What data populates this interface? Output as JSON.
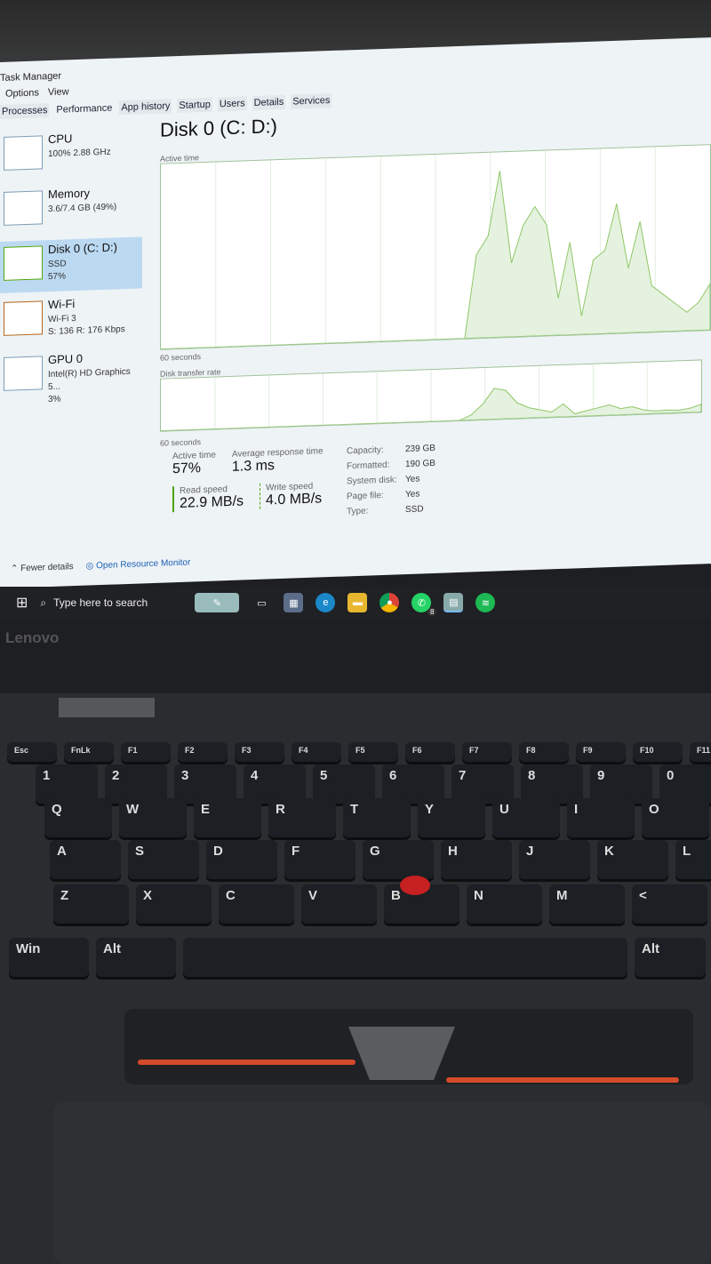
{
  "window": {
    "title": "Task Manager",
    "menu": [
      "Options",
      "View"
    ],
    "tabs": [
      "Processes",
      "Performance",
      "App history",
      "Startup",
      "Users",
      "Details",
      "Services"
    ],
    "active_tab": "Performance"
  },
  "sidebar": [
    {
      "name": "CPU",
      "line1": "100% 2.88 GHz",
      "line2": ""
    },
    {
      "name": "Memory",
      "line1": "3.6/7.4 GB (49%)",
      "line2": ""
    },
    {
      "name": "Disk 0 (C: D:)",
      "line1": "SSD",
      "line2": "57%",
      "selected": true
    },
    {
      "name": "Wi-Fi",
      "line1": "Wi-Fi 3",
      "line2": "S: 136 R: 176 Kbps"
    },
    {
      "name": "GPU 0",
      "line1": "Intel(R) HD Graphics 5...",
      "line2": "3%"
    }
  ],
  "main": {
    "title": "Disk 0 (C: D:)",
    "graph1_label": "Active time",
    "graph1_time": "60 seconds",
    "graph2_label": "Disk transfer rate",
    "graph2_time": "60 seconds",
    "active_time_series": [
      0,
      0,
      0,
      0,
      0,
      0,
      0,
      0,
      0,
      0,
      0,
      0,
      0,
      0,
      0,
      0,
      0,
      0,
      0,
      0,
      0,
      0,
      0,
      0,
      0,
      0,
      0,
      45,
      55,
      90,
      40,
      60,
      70,
      60,
      20,
      50,
      10,
      40,
      45,
      70,
      35,
      60,
      25,
      20,
      15,
      10,
      15,
      25
    ],
    "transfer_series": [
      0,
      0,
      0,
      0,
      0,
      0,
      0,
      0,
      0,
      0,
      0,
      0,
      0,
      0,
      0,
      0,
      0,
      0,
      0,
      0,
      0,
      0,
      0,
      0,
      0,
      0,
      0,
      10,
      30,
      60,
      55,
      30,
      20,
      15,
      10,
      25,
      5,
      10,
      15,
      20,
      12,
      15,
      8,
      5,
      6,
      5,
      8,
      15
    ],
    "accent": "#4da60c"
  },
  "stats": {
    "active_time_label": "Active time",
    "active_time": "57%",
    "resp_label": "Average response time",
    "resp": "1.3 ms",
    "read_label": "Read speed",
    "read": "22.9 MB/s",
    "write_label": "Write speed",
    "write": "4.0 MB/s",
    "props": [
      [
        "Capacity:",
        "239 GB"
      ],
      [
        "Formatted:",
        "190 GB"
      ],
      [
        "System disk:",
        "Yes"
      ],
      [
        "Page file:",
        "Yes"
      ],
      [
        "Type:",
        "SSD"
      ]
    ]
  },
  "footer": {
    "fewer": "Fewer details",
    "monitor": "Open Resource Monitor"
  },
  "taskbar": {
    "search": "Type here to search",
    "badge": "8"
  },
  "laptop": {
    "brand": "Lenovo"
  },
  "keyboard": {
    "f": [
      "Esc",
      "FnLk",
      "F1",
      "F2",
      "F3",
      "F4",
      "F5",
      "F6",
      "F7",
      "F8",
      "F9",
      "F10",
      "F11"
    ],
    "r1": [
      "1",
      "2",
      "3",
      "4",
      "5",
      "6",
      "7",
      "8",
      "9",
      "0"
    ],
    "r2": [
      "Q",
      "W",
      "E",
      "R",
      "T",
      "Y",
      "U",
      "I",
      "O"
    ],
    "r3": [
      "A",
      "S",
      "D",
      "F",
      "G",
      "H",
      "J",
      "K",
      "L"
    ],
    "r4": [
      "Z",
      "X",
      "C",
      "V",
      "B",
      "N",
      "M",
      "<"
    ],
    "r5": [
      "Win",
      "Alt",
      "",
      "Alt"
    ]
  }
}
